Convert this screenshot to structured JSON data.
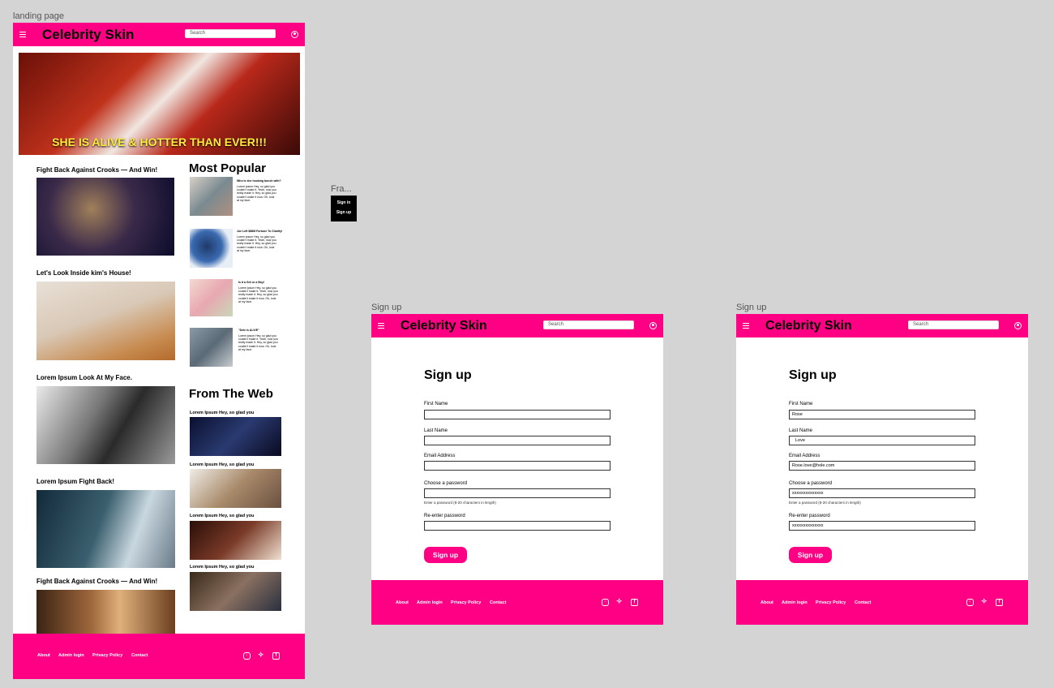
{
  "canvas": {
    "landing_label": "landing page",
    "popup_label": "Fra...",
    "signup_label_1": "Sign up",
    "signup_label_2": "Sign up"
  },
  "brand": {
    "name": "Celebrity Skin",
    "accent": "#ff0085"
  },
  "header": {
    "search_placeholder": "Search"
  },
  "hero": {
    "headline": "SHE IS ALIVE & HOTTER THAN EVER!!!"
  },
  "stories": [
    {
      "title": "Fight Back Against Crooks — And Win!"
    },
    {
      "title": "Let's Look Inside kim's House!"
    },
    {
      "title": "Lorem Ipsum Look At My Face."
    },
    {
      "title": "Lorem Ipsum Fight Back!"
    },
    {
      "title": "Fight Back Against Crooks — And Win!"
    }
  ],
  "most_popular": {
    "heading": "Most Popular",
    "items": [
      {
        "title": "Who is she hooking bunch with?",
        "body": "Lorem ipsum Hey, so glad you couldn't make it. Yeah, now you really made it. Hey, so glad you couldn't make it now. Oh, look at my face."
      },
      {
        "title": "Joe Left $88M Fortune To Charity!",
        "body": "Lorem ipsum Hey, so glad you couldn't make it. Yeah, now you really made it. Hey, so glad you couldn't make it now. Oh, look at my face."
      },
      {
        "title": "Is it a Girl or a Boy!",
        "body": "Lorem ipsum Hey, so glad you couldn't make it. Yeah, now you really made it. Hey, so glad you couldn't make it now. Oh, look at my face."
      },
      {
        "title": "\"Dele is ALIVE\"",
        "body": "Lorem ipsum Hey, so glad you couldn't make it. Yeah, now you really made it. Hey, so glad you couldn't make it now. Oh, look at my face."
      }
    ]
  },
  "from_the_web": {
    "heading": "From The Web",
    "items": [
      {
        "title": "Lorem Ipsum Hey, so glad you"
      },
      {
        "title": "Lorem Ipsum Hey, so glad you"
      },
      {
        "title": "Lorem Ipsum Hey, so glad you"
      },
      {
        "title": "Lorem Ipsum Hey, so glad you"
      }
    ]
  },
  "footer": {
    "links": [
      "About",
      "Admin login",
      "Privacy Policy",
      "Contact"
    ],
    "social_icons": [
      "instagram-icon",
      "twitter-icon",
      "facebook-icon"
    ]
  },
  "popup": {
    "sign_in": "Sign in",
    "sign_up": "Sign up"
  },
  "signup": {
    "title": "Sign up",
    "first_name_label": "First Name",
    "last_name_label": "Last Name",
    "email_label": "Email Address",
    "password_label": "Choose a password",
    "password_hint": "Enter a password (8-20 characters in length)",
    "reenter_label": "Re-enter password",
    "button": "Sign up"
  },
  "signup_filled": {
    "first_name": "Rose",
    "last_name": "Love",
    "email": "Rose.love@hole.com",
    "password": "xxxxxxxxxxxxxx",
    "reenter": "xxxxxxxxxxxxxx"
  }
}
